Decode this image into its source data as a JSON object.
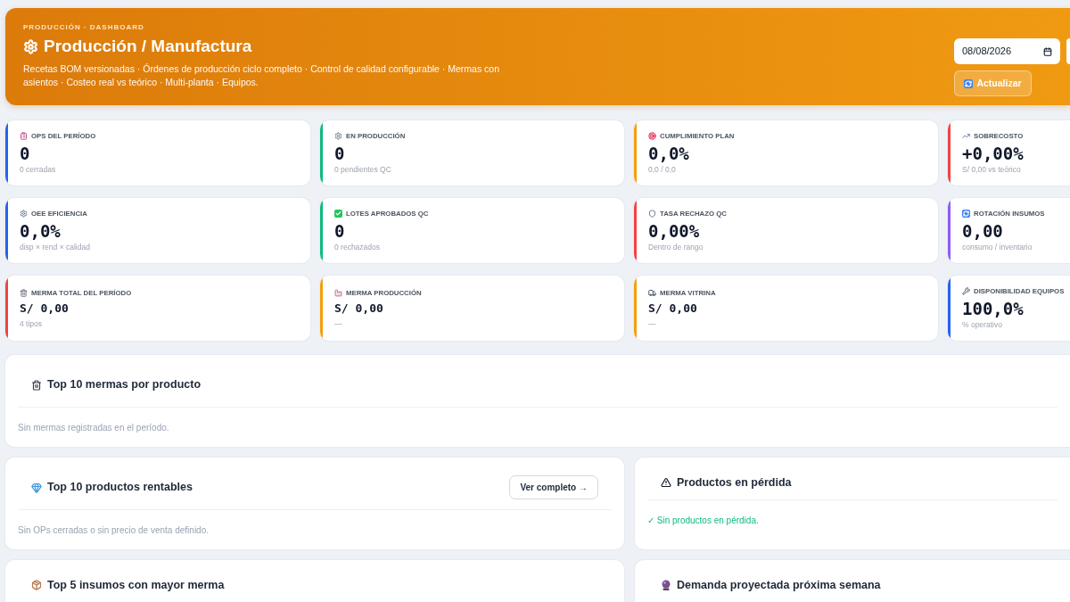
{
  "header": {
    "eyebrow": "PRODUCCIÓN · DASHBOARD",
    "title": "Producción / Manufactura",
    "description": "Recetas BOM versionadas · Órdenes de producción ciclo completo · Control de calidad configurable · Mermas con asientos · Costeo real vs teórico · Multi-planta · Equipos.",
    "date_field": {
      "value": "08/08/2026"
    },
    "refresh_button": "Actualizar"
  },
  "kpis": [
    {
      "label": "OPS DEL PERÍODO",
      "value": "0",
      "sub": "0 cerradas",
      "color": "#2563eb",
      "kind": "metric"
    },
    {
      "label": "EN PRODUCCIÓN",
      "value": "0",
      "sub": "0 pendientes QC",
      "color": "#10b981",
      "kind": "metric"
    },
    {
      "label": "CUMPLIMIENTO PLAN",
      "value": "0,0%",
      "sub": "0,0 / 0,0",
      "color": "#f59e0b",
      "kind": "metric"
    },
    {
      "label": "SOBRECOSTO",
      "value": "+0,00%",
      "sub": "S/ 0,00 vs teórico",
      "color": "#ef4444",
      "kind": "metric"
    },
    {
      "label": "OEE EFICIENCIA",
      "value": "0,0%",
      "sub": "disp × rend × calidad",
      "color": "#2563eb",
      "kind": "metric"
    },
    {
      "label": "LOTES APROBADOS QC",
      "value": "0",
      "sub": "0 rechazados",
      "color": "#10b981",
      "kind": "metric"
    },
    {
      "label": "TASA RECHAZO QC",
      "value": "0,00%",
      "sub": "Dentro de rango",
      "color": "#ef4444",
      "kind": "metric"
    },
    {
      "label": "ROTACIÓN INSUMOS",
      "value": "0,00",
      "sub": "consumo / inventario",
      "color": "#8b5cf6",
      "kind": "metric"
    },
    {
      "label": "MERMA TOTAL DEL PERÍODO",
      "value": "S/ 0,00",
      "sub": "4 tipos",
      "color": "#ef4444",
      "kind": "amount"
    },
    {
      "label": "MERMA PRODUCCIÓN",
      "value": "S/ 0,00",
      "sub": "—",
      "color": "#f59e0b",
      "kind": "amount"
    },
    {
      "label": "MERMA VITRINA",
      "value": "S/ 0,00",
      "sub": "—",
      "color": "#f59e0b",
      "kind": "amount"
    },
    {
      "label": "DISPONIBILIDAD EQUIPOS",
      "value": "100,0%",
      "sub": "% operativo",
      "color": "#2563eb",
      "kind": "metric"
    }
  ],
  "panel_rows": [
    {
      "panels": [
        {
          "title": "Top 10 mermas por producto",
          "message": {
            "text": "Sin mermas registradas en el período.",
            "kind": "empty"
          }
        }
      ]
    },
    {
      "panels": [
        {
          "title": "Top 10 productos rentables",
          "action": "Ver completo →",
          "message": {
            "text": "Sin OPs cerradas o sin precio de venta definido.",
            "kind": "empty"
          }
        },
        {
          "title": "Productos en pérdida",
          "message": {
            "text": "✓ Sin productos en pérdida.",
            "kind": "success"
          }
        }
      ]
    },
    {
      "panels": [
        {
          "title": "Top 5 insumos con mayor merma"
        },
        {
          "title": "Demanda proyectada próxima semana"
        }
      ]
    }
  ]
}
